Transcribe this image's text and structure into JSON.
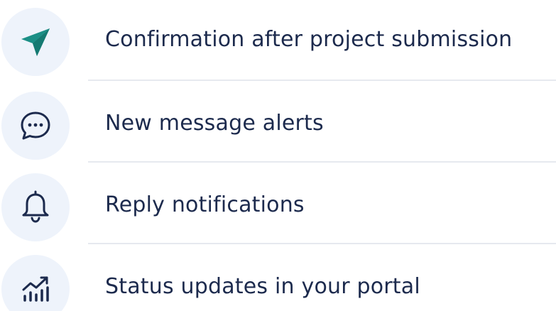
{
  "colors": {
    "text": "#1c2a4d",
    "icon_dark": "#1c2a4d",
    "icon_teal": "#1b8f86",
    "icon_bg": "#eef3fb",
    "divider": "#e6e9ef"
  },
  "items": [
    {
      "label": "Confirmation after project submission",
      "icon": "paper-plane-icon"
    },
    {
      "label": "New message alerts",
      "icon": "chat-bubble-icon"
    },
    {
      "label": "Reply notifications",
      "icon": "bell-icon"
    },
    {
      "label": "Status updates in your portal",
      "icon": "chart-trend-icon"
    }
  ]
}
